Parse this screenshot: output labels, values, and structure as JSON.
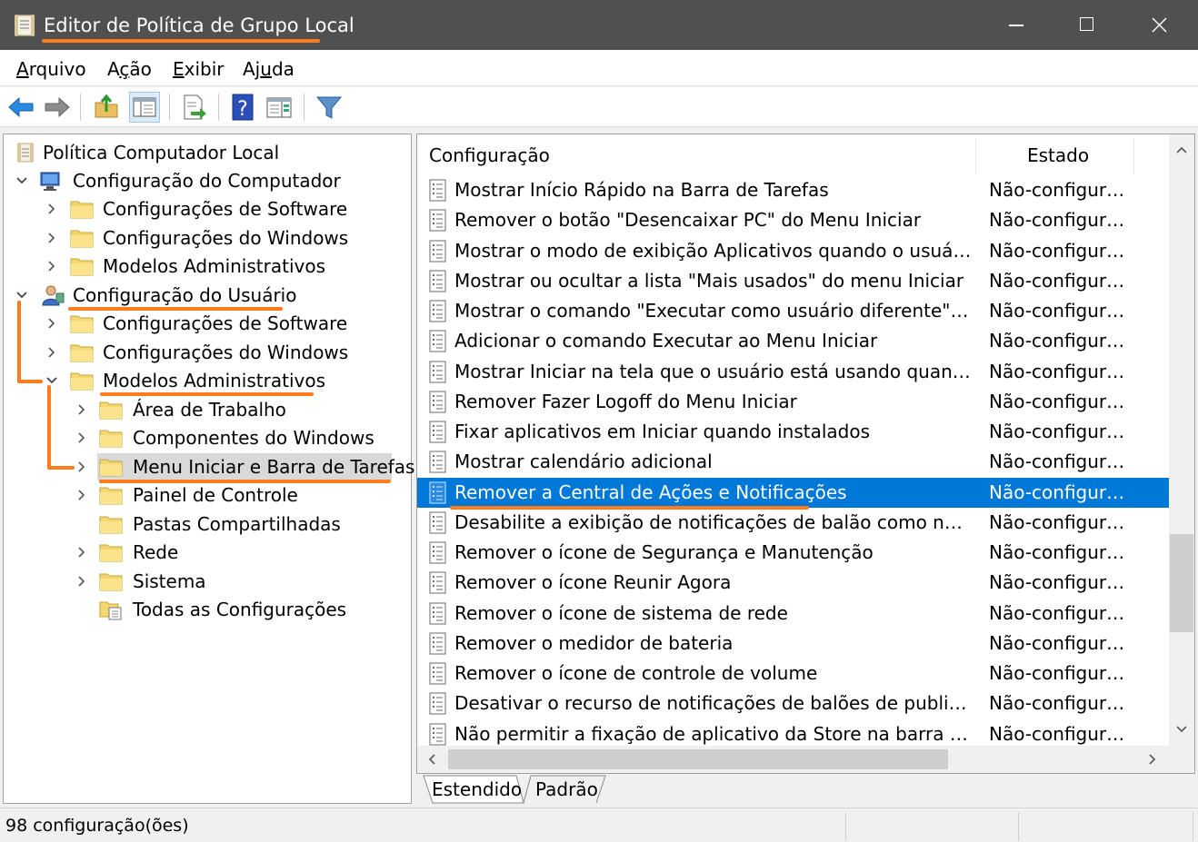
{
  "window": {
    "title": "Editor de Política de Grupo Local"
  },
  "menu": [
    {
      "pre": "",
      "acc": "A",
      "post": "rquivo"
    },
    {
      "pre": "A",
      "acc": "ç",
      "post": "ão"
    },
    {
      "pre": "",
      "acc": "E",
      "post": "xibir"
    },
    {
      "pre": "Aj",
      "acc": "u",
      "post": "da"
    }
  ],
  "tree": {
    "root": "Política Computador Local",
    "computer_config": "Configuração do Computador",
    "cc_software": "Configurações de Software",
    "cc_windows": "Configurações do Windows",
    "cc_admin": "Modelos Administrativos",
    "user_config": "Configuração do Usuário",
    "uc_software": "Configurações de Software",
    "uc_windows": "Configurações do Windows",
    "uc_admin": "Modelos Administrativos",
    "desktop": "Área de Trabalho",
    "win_components": "Componentes do Windows",
    "start_menu": "Menu Iniciar e Barra de Tarefas",
    "control_panel": "Painel de Controle",
    "shared_folders": "Pastas Compartilhadas",
    "network": "Rede",
    "system": "Sistema",
    "all_settings": "Todas as Configurações"
  },
  "list": {
    "col_setting": "Configuração",
    "col_state": "Estado",
    "rows": [
      {
        "name": "Mostrar Início Rápido na Barra de Tarefas",
        "state": "Não-configurada"
      },
      {
        "name": "Remover o botão \"Desencaixar PC\" do Menu Iniciar",
        "state": "Não-configurada"
      },
      {
        "name": "Mostrar o modo de exibição Aplicativos quando o usuário for para Iniciar",
        "state": "Não-configurada"
      },
      {
        "name": "Mostrar ou ocultar a lista \"Mais usados\" do menu Iniciar",
        "state": "Não-configurada"
      },
      {
        "name": "Mostrar o comando \"Executar como usuário diferente\" em Iniciar",
        "state": "Não-configurada"
      },
      {
        "name": "Adicionar o comando Executar ao Menu Iniciar",
        "state": "Não-configurada"
      },
      {
        "name": "Mostrar Iniciar na tela que o usuário está usando quando ele pressiona a tecla Windows",
        "state": "Não-configurada"
      },
      {
        "name": "Remover Fazer Logoff do Menu Iniciar",
        "state": "Não-configurada"
      },
      {
        "name": "Fixar aplicativos em Iniciar quando instalados",
        "state": "Não-configurada"
      },
      {
        "name": "Mostrar calendário adicional",
        "state": "Não-configurada"
      },
      {
        "name": "Remover a Central de Ações e Notificações",
        "state": "Não-configurada"
      },
      {
        "name": "Desabilite a exibição de notificações de balão como notificações do sistema",
        "state": "Não-configurada"
      },
      {
        "name": "Remover o ícone de Segurança e Manutenção",
        "state": "Não-configurada"
      },
      {
        "name": "Remover o ícone Reunir Agora",
        "state": "Não-configurada"
      },
      {
        "name": "Remover o ícone de sistema de rede",
        "state": "Não-configurada"
      },
      {
        "name": "Remover o medidor de bateria",
        "state": "Não-configurada"
      },
      {
        "name": "Remover o ícone de controle de volume",
        "state": "Não-configurada"
      },
      {
        "name": "Desativar o recurso de notificações de balões de publicidade",
        "state": "Não-configurada"
      },
      {
        "name": "Não permitir a fixação de aplicativo da Store na barra de tarefas",
        "state": "Não-configurada"
      }
    ]
  },
  "tabs": {
    "extended": "Estendido",
    "standard": "Padrão"
  },
  "status": {
    "count_text": "98 configuração(ões)"
  },
  "colors": {
    "selection": "#0078d7",
    "annotation": "#ff7b1c",
    "titlebar": "#505050"
  }
}
